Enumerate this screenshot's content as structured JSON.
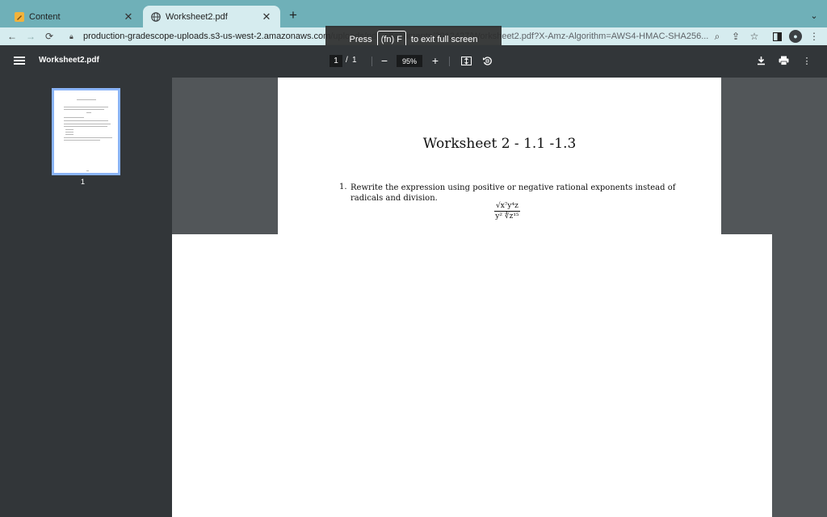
{
  "tabs": [
    {
      "title": "Content",
      "icon": "pencil-icon"
    },
    {
      "title": "Worksheet2.pdf",
      "icon": "globe-icon"
    }
  ],
  "toolbar": {
    "url_domain": "production-gradescope-uploads.s3-us-west-2.amazonaws.com",
    "url_path": "/uploads/pdf_attachments/2012427/Worksheet2.pdf?X-Amz-Algorithm=AWS4-HMAC-SHA256..."
  },
  "toast": {
    "before": "Press",
    "key": "(fn) F",
    "after": "to exit full screen"
  },
  "pdf_viewer": {
    "file_name": "Worksheet2.pdf",
    "current_page": "1",
    "page_separator": "/",
    "total_pages": "1",
    "zoom": "95%"
  },
  "sidebar": {
    "thumbnail_label": "1"
  },
  "document": {
    "title": "Worksheet 2 - 1.1 -1.3",
    "question_number": "1.",
    "question_text": "Rewrite the expression using positive or negative rational exponents instead of radicals and division.",
    "expression_numerator": "√x⁷y⁴z",
    "expression_denominator": "y² ∜z¹⁵"
  },
  "colors": {
    "tab_strip": "#6fb0b8",
    "active_tab": "#d6ecef",
    "pdf_toolbar": "#323639",
    "viewer_background": "#525659",
    "thumbnail_border": "#8ab4f8"
  }
}
